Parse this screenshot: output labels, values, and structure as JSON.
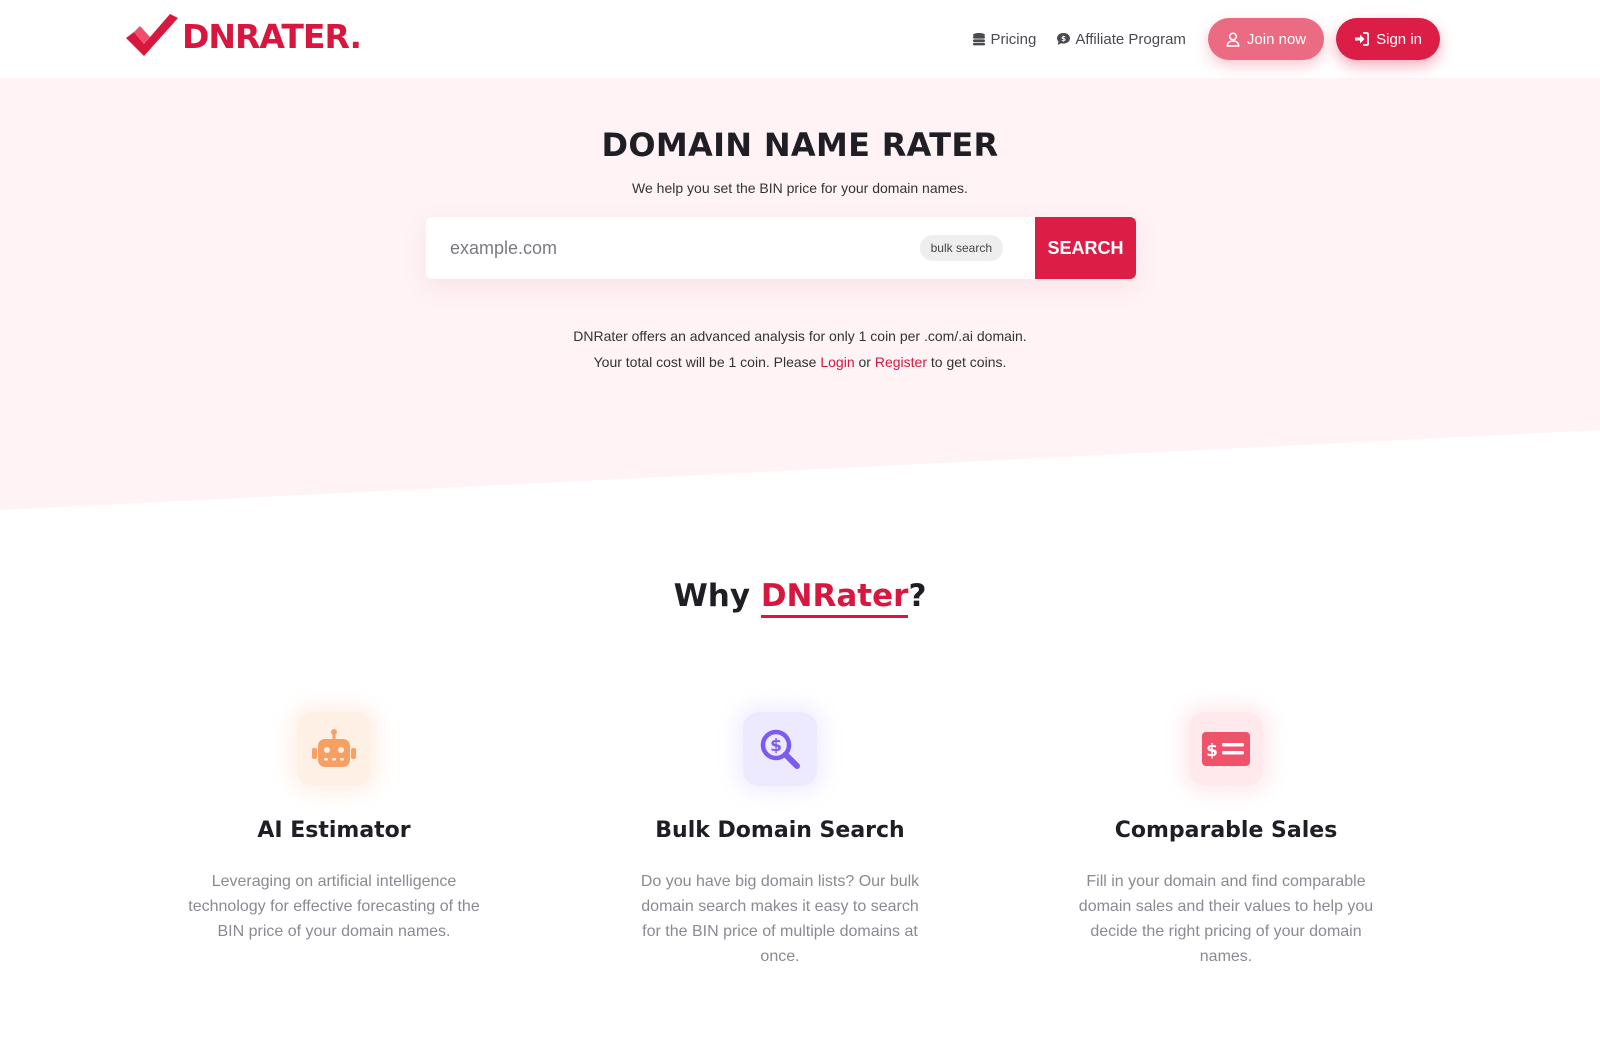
{
  "brand": {
    "name": "DNRATER",
    "dot": ".",
    "color": "#d8173f"
  },
  "nav": {
    "pricing": "Pricing",
    "affiliate": "Affiliate Program",
    "join": "Join now",
    "signin": "Sign in"
  },
  "hero": {
    "title": "DOMAIN NAME RATER",
    "subtitle": "We help you set the BIN price for your domain names.",
    "search": {
      "placeholder": "example.com",
      "bulk_label": "bulk search",
      "button": "SEARCH"
    },
    "info_line1": "DNRater offers an advanced analysis for only 1 coin per .com/.ai domain.",
    "info_line2_before": "Your total cost will be 1 coin. Please ",
    "login": "Login",
    "or": " or ",
    "register": "Register",
    "info_line2_after": " to get coins."
  },
  "why": {
    "prefix": "Why ",
    "brand": "DNRater",
    "suffix": "?"
  },
  "features": [
    {
      "icon": "robot-icon",
      "title": "AI Estimator",
      "desc": "Leveraging on artificial intelligence technology for effective forecasting of the BIN price of your domain names."
    },
    {
      "icon": "search-dollar-icon",
      "title": "Bulk Domain Search",
      "desc": "Do you have big domain lists? Our bulk domain search makes it easy to search for the BIN price of multiple domains at once."
    },
    {
      "icon": "money-check-icon",
      "title": "Comparable Sales",
      "desc": "Fill in your domain and find comparable domain sales and their values to help you decide the right pricing of your domain names."
    }
  ],
  "colors": {
    "accent": "#dc1d45",
    "join": "#ea6b82",
    "hero_bg": "#fff3f5"
  }
}
